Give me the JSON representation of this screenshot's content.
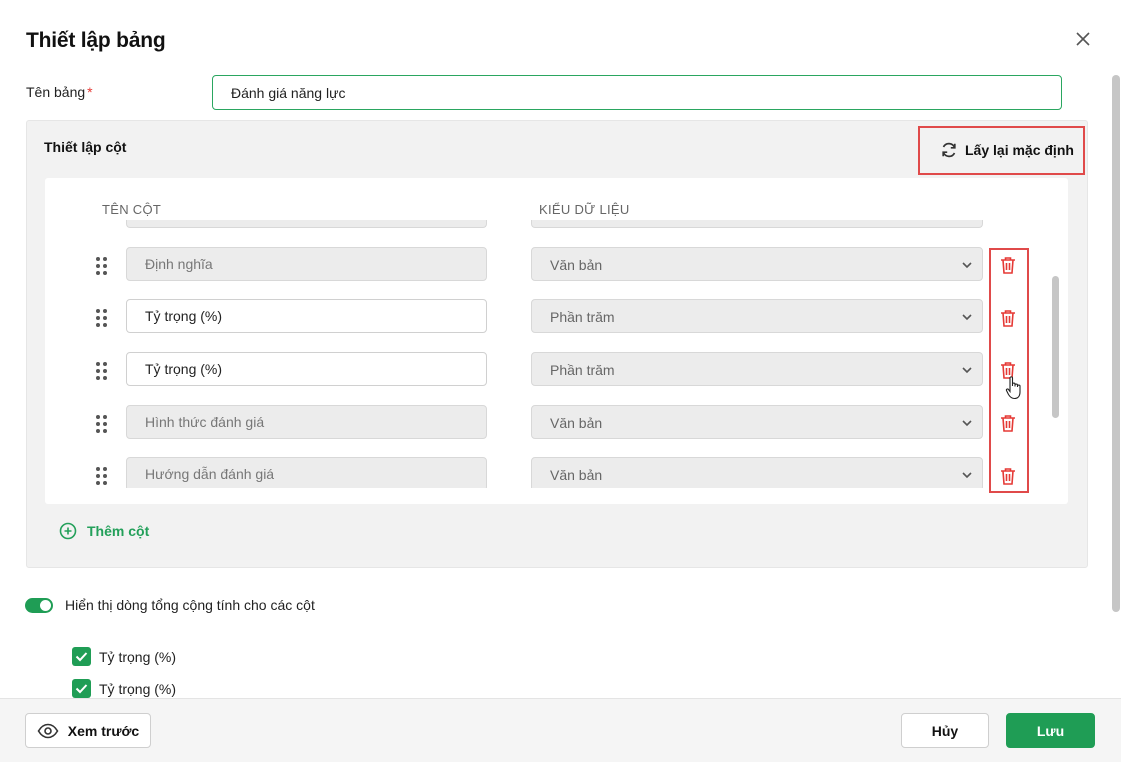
{
  "dialog": {
    "title": "Thiết lập bảng",
    "close_icon": "close-icon"
  },
  "table_name": {
    "label": "Tên bảng",
    "required_mark": "*",
    "value": "Đánh giá năng lực"
  },
  "columns": {
    "title": "Thiết lập cột",
    "reset_label": "Lấy lại mặc định",
    "header_name": "TÊN CỘT",
    "header_type": "KIỂU DỮ LIỆU",
    "rows": [
      {
        "name": "Định nghĩa",
        "type": "Văn bản",
        "editable": false
      },
      {
        "name": "Tỷ trọng (%)",
        "type": "Phần trăm",
        "editable": true
      },
      {
        "name": "Tỷ trọng (%)",
        "type": "Phần trăm",
        "editable": true
      },
      {
        "name": "Hình thức đánh giá",
        "type": "Văn bản",
        "editable": false
      },
      {
        "name": "Hướng dẫn đánh giá",
        "type": "Văn bản",
        "editable": false
      }
    ],
    "add_label": "Thêm cột"
  },
  "totals": {
    "toggle_on": true,
    "toggle_label": "Hiển thị dòng tổng cộng tính cho các cột",
    "checks": [
      {
        "label": "Tỷ trọng (%)",
        "checked": true
      },
      {
        "label": "Tỷ trọng (%)",
        "checked": true
      }
    ]
  },
  "footer": {
    "preview_label": "Xem trước",
    "cancel_label": "Hủy",
    "save_label": "Lưu"
  },
  "colors": {
    "accent": "#1f9d55",
    "danger": "#e53935",
    "highlight_box": "#e04a4a"
  }
}
